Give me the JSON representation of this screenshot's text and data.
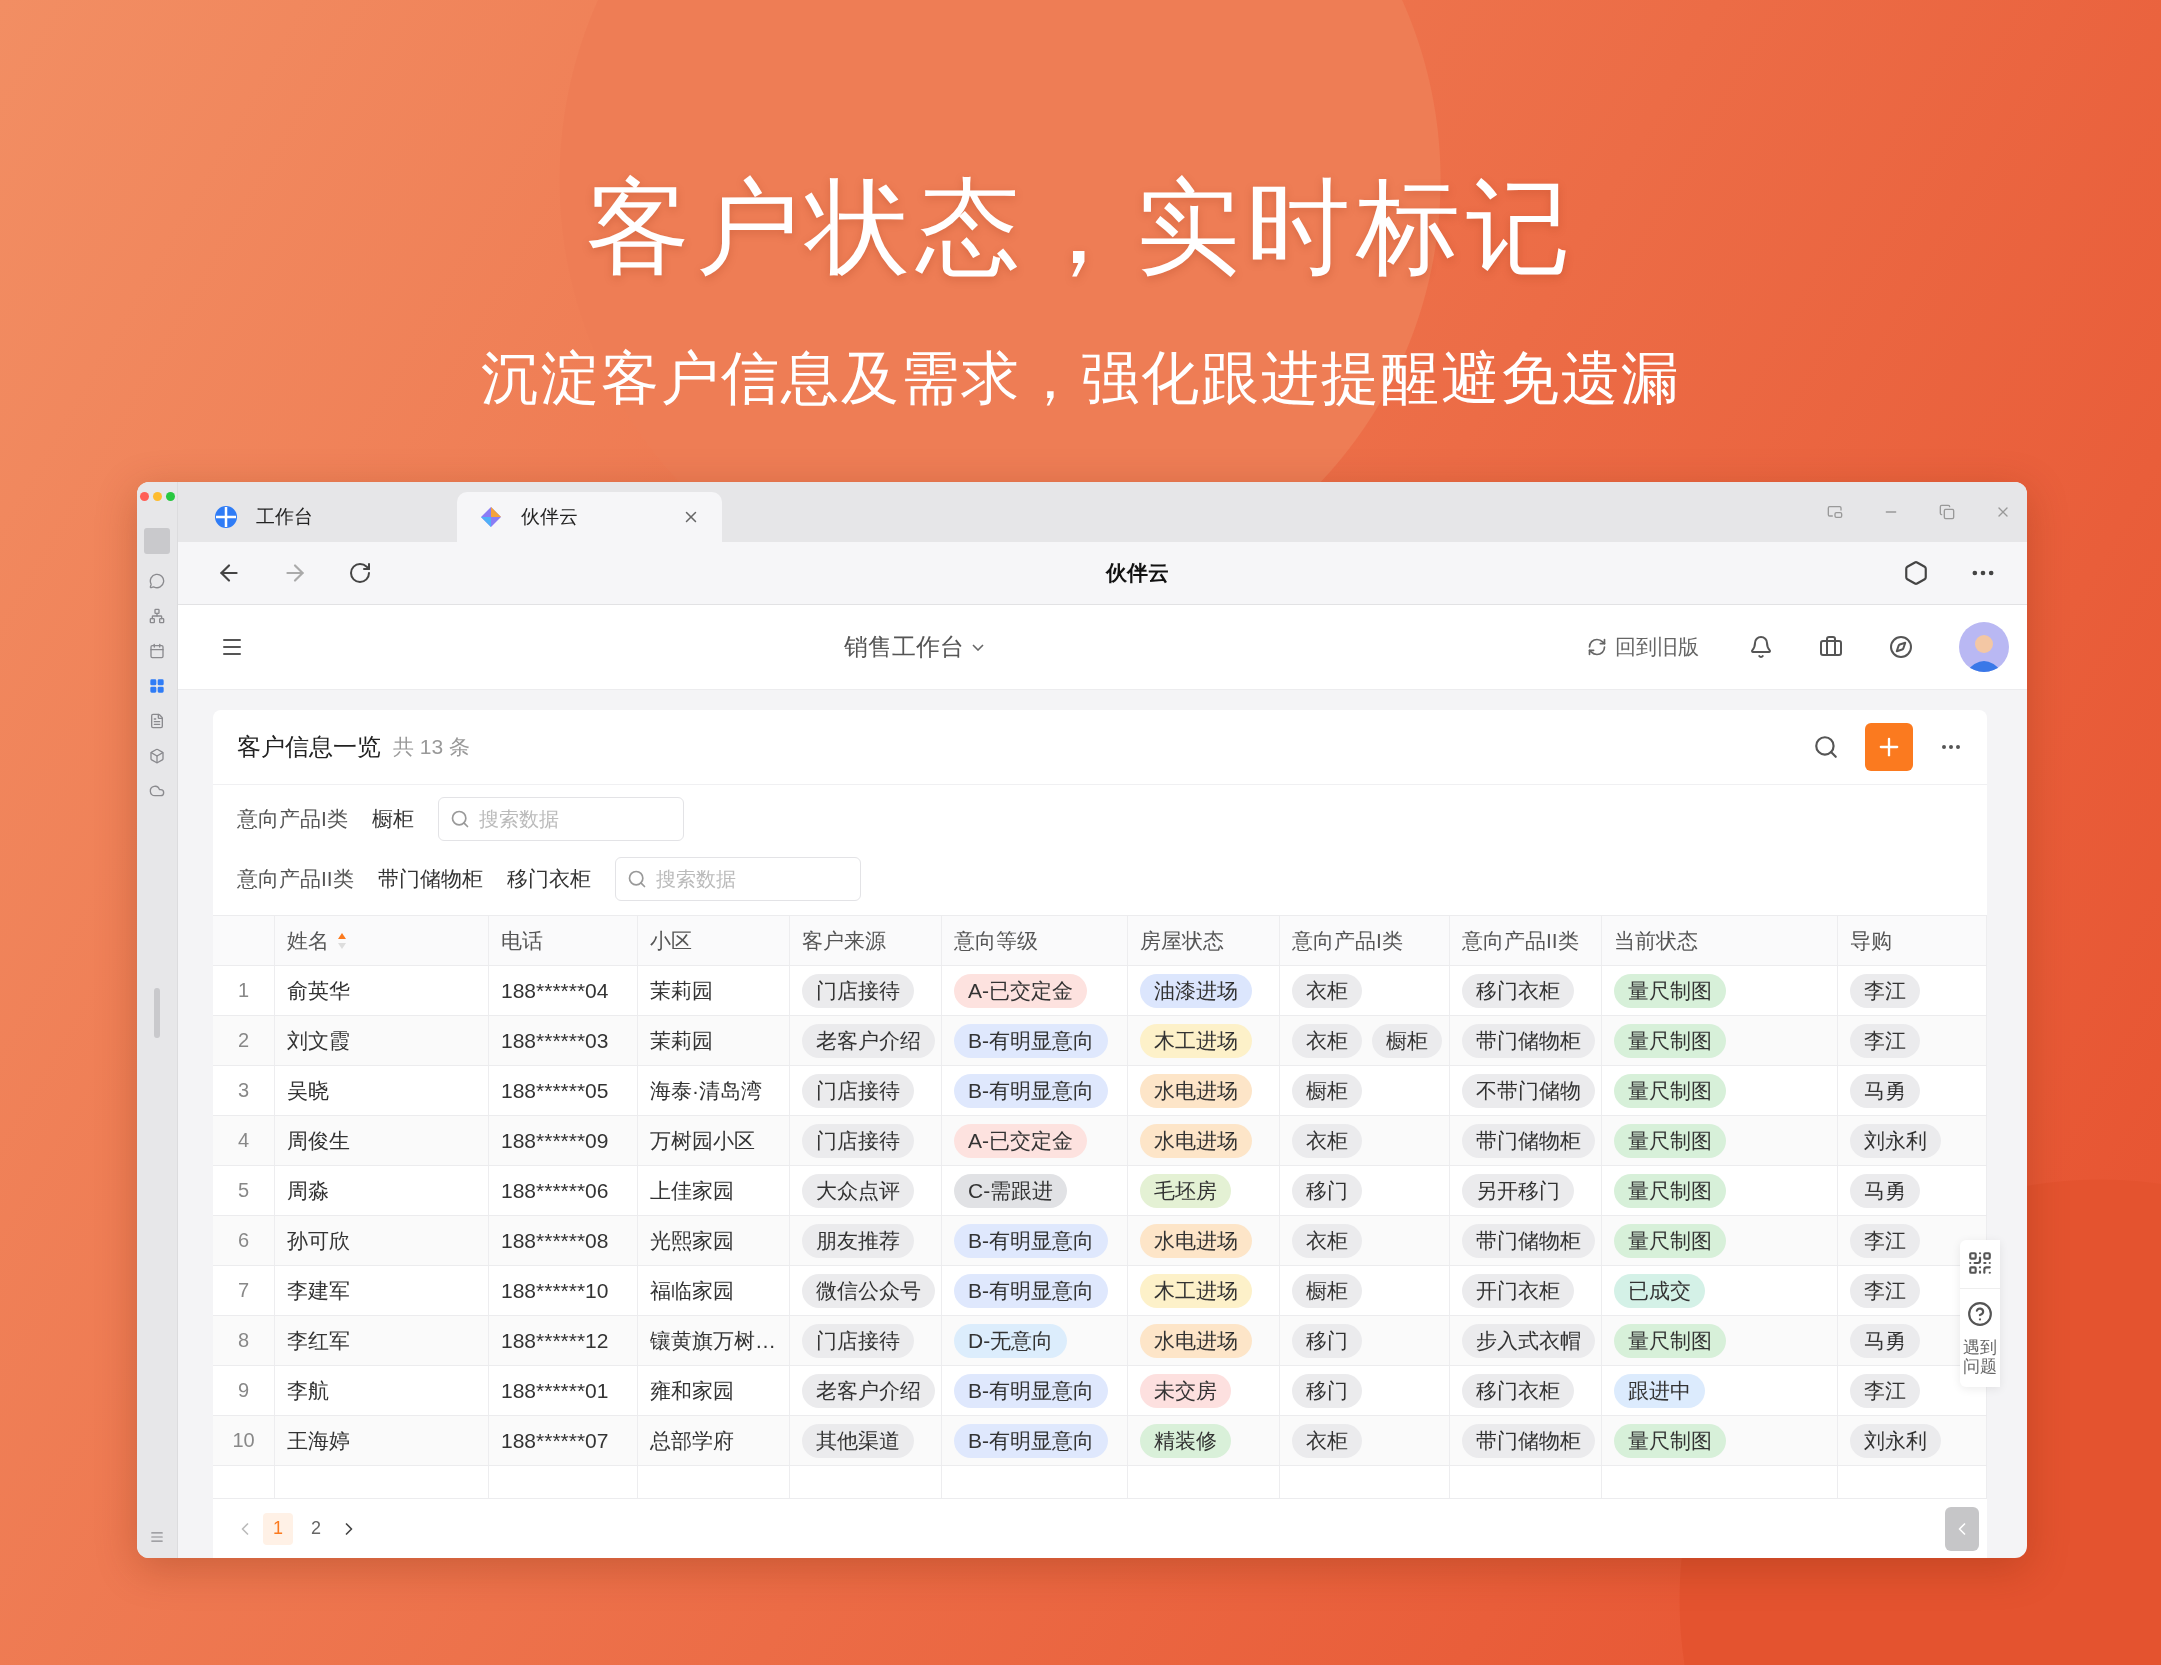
{
  "hero": {
    "title": "客户状态，实时标记",
    "subtitle": "沉淀客户信息及需求，强化跟进提醒避免遗漏"
  },
  "browser": {
    "tabs": [
      {
        "label": "工作台",
        "selected": false
      },
      {
        "label": "伙伴云",
        "selected": true
      }
    ],
    "page_title": "伙伴云"
  },
  "app_header": {
    "workspace": "销售工作台",
    "old_version": "回到旧版"
  },
  "card": {
    "title": "客户信息一览",
    "count": "共 13 条"
  },
  "filters": [
    {
      "label": "意向产品I类",
      "values": [
        "橱柜"
      ],
      "placeholder": "搜索数据"
    },
    {
      "label": "意向产品II类",
      "values": [
        "带门储物柜",
        "移门衣柜"
      ],
      "placeholder": "搜索数据"
    }
  ],
  "table": {
    "columns": [
      {
        "label": "姓名",
        "sorted": true
      },
      {
        "label": "电话",
        "sorted": false
      },
      {
        "label": "小区",
        "sorted": false
      },
      {
        "label": "客户来源",
        "sorted": false
      },
      {
        "label": "意向等级",
        "sorted": false
      },
      {
        "label": "房屋状态",
        "sorted": false
      },
      {
        "label": "意向产品I类",
        "sorted": false
      },
      {
        "label": "意向产品II类",
        "sorted": false
      },
      {
        "label": "当前状态",
        "sorted": false
      },
      {
        "label": "导购",
        "sorted": false
      }
    ],
    "rows": [
      {
        "index": "1",
        "cells": [
          {
            "kind": "text",
            "text": "俞英华"
          },
          {
            "kind": "text",
            "text": "188******04"
          },
          {
            "kind": "text",
            "text": "茉莉园"
          },
          {
            "kind": "tags",
            "tags": [
              {
                "text": "门店接待",
                "color": "#ebebed"
              }
            ]
          },
          {
            "kind": "tags",
            "tags": [
              {
                "text": "A-已交定金",
                "color": "#fde2df"
              }
            ]
          },
          {
            "kind": "tags",
            "tags": [
              {
                "text": "油漆进场",
                "color": "#dce6fd"
              }
            ]
          },
          {
            "kind": "tags",
            "tags": [
              {
                "text": "衣柜",
                "color": "#ebebed"
              }
            ]
          },
          {
            "kind": "tags",
            "tags": [
              {
                "text": "移门衣柜",
                "color": "#ebebed"
              }
            ]
          },
          {
            "kind": "tags",
            "tags": [
              {
                "text": "量尺制图",
                "color": "#d7f0d9"
              }
            ]
          },
          {
            "kind": "tags",
            "tags": [
              {
                "text": "李江",
                "color": "#ebebed"
              }
            ]
          }
        ]
      },
      {
        "index": "2",
        "cells": [
          {
            "kind": "text",
            "text": "刘文霞"
          },
          {
            "kind": "text",
            "text": "188******03"
          },
          {
            "kind": "text",
            "text": "茉莉园"
          },
          {
            "kind": "tags",
            "tags": [
              {
                "text": "老客户介绍",
                "color": "#ebebed"
              }
            ]
          },
          {
            "kind": "tags",
            "tags": [
              {
                "text": "B-有明显意向",
                "color": "#dfe8fd"
              }
            ]
          },
          {
            "kind": "tags",
            "tags": [
              {
                "text": "木工进场",
                "color": "#fdf1c9"
              }
            ]
          },
          {
            "kind": "tags",
            "tags": [
              {
                "text": "衣柜",
                "color": "#ebebed"
              },
              {
                "text": "橱柜",
                "color": "#ebebed"
              }
            ]
          },
          {
            "kind": "tags",
            "tags": [
              {
                "text": "带门储物柜",
                "color": "#ebebed"
              }
            ]
          },
          {
            "kind": "tags",
            "tags": [
              {
                "text": "量尺制图",
                "color": "#d7f0d9"
              }
            ]
          },
          {
            "kind": "tags",
            "tags": [
              {
                "text": "李江",
                "color": "#ebebed"
              }
            ]
          }
        ]
      },
      {
        "index": "3",
        "cells": [
          {
            "kind": "text",
            "text": "吴晓"
          },
          {
            "kind": "text",
            "text": "188******05"
          },
          {
            "kind": "text",
            "text": "海泰·清岛湾"
          },
          {
            "kind": "tags",
            "tags": [
              {
                "text": "门店接待",
                "color": "#ebebed"
              }
            ]
          },
          {
            "kind": "tags",
            "tags": [
              {
                "text": "B-有明显意向",
                "color": "#dfe8fd"
              }
            ]
          },
          {
            "kind": "tags",
            "tags": [
              {
                "text": "水电进场",
                "color": "#fde5c8"
              }
            ]
          },
          {
            "kind": "tags",
            "tags": [
              {
                "text": "橱柜",
                "color": "#ebebed"
              }
            ]
          },
          {
            "kind": "tags",
            "tags": [
              {
                "text": "不带门储物",
                "color": "#ebebed"
              }
            ]
          },
          {
            "kind": "tags",
            "tags": [
              {
                "text": "量尺制图",
                "color": "#d7f0d9"
              }
            ]
          },
          {
            "kind": "tags",
            "tags": [
              {
                "text": "马勇",
                "color": "#ebebed"
              }
            ]
          }
        ]
      },
      {
        "index": "4",
        "cells": [
          {
            "kind": "text",
            "text": "周俊生"
          },
          {
            "kind": "text",
            "text": "188******09"
          },
          {
            "kind": "text",
            "text": "万树园小区"
          },
          {
            "kind": "tags",
            "tags": [
              {
                "text": "门店接待",
                "color": "#ebebed"
              }
            ]
          },
          {
            "kind": "tags",
            "tags": [
              {
                "text": "A-已交定金",
                "color": "#fde2df"
              }
            ]
          },
          {
            "kind": "tags",
            "tags": [
              {
                "text": "水电进场",
                "color": "#fde5c8"
              }
            ]
          },
          {
            "kind": "tags",
            "tags": [
              {
                "text": "衣柜",
                "color": "#ebebed"
              }
            ]
          },
          {
            "kind": "tags",
            "tags": [
              {
                "text": "带门储物柜",
                "color": "#ebebed"
              }
            ]
          },
          {
            "kind": "tags",
            "tags": [
              {
                "text": "量尺制图",
                "color": "#d7f0d9"
              }
            ]
          },
          {
            "kind": "tags",
            "tags": [
              {
                "text": "刘永利",
                "color": "#ebebed"
              }
            ]
          }
        ]
      },
      {
        "index": "5",
        "cells": [
          {
            "kind": "text",
            "text": "周淼"
          },
          {
            "kind": "text",
            "text": "188******06"
          },
          {
            "kind": "text",
            "text": "上佳家园"
          },
          {
            "kind": "tags",
            "tags": [
              {
                "text": "大众点评",
                "color": "#ebebed"
              }
            ]
          },
          {
            "kind": "tags",
            "tags": [
              {
                "text": "C-需跟进",
                "color": "#e1e2e5"
              }
            ]
          },
          {
            "kind": "tags",
            "tags": [
              {
                "text": "毛坯房",
                "color": "#e4f1d4"
              }
            ]
          },
          {
            "kind": "tags",
            "tags": [
              {
                "text": "移门",
                "color": "#ebebed"
              }
            ]
          },
          {
            "kind": "tags",
            "tags": [
              {
                "text": "另开移门",
                "color": "#ebebed"
              }
            ]
          },
          {
            "kind": "tags",
            "tags": [
              {
                "text": "量尺制图",
                "color": "#d7f0d9"
              }
            ]
          },
          {
            "kind": "tags",
            "tags": [
              {
                "text": "马勇",
                "color": "#ebebed"
              }
            ]
          }
        ]
      },
      {
        "index": "6",
        "cells": [
          {
            "kind": "text",
            "text": "孙可欣"
          },
          {
            "kind": "text",
            "text": "188******08"
          },
          {
            "kind": "text",
            "text": "光熙家园"
          },
          {
            "kind": "tags",
            "tags": [
              {
                "text": "朋友推荐",
                "color": "#ebebed"
              }
            ]
          },
          {
            "kind": "tags",
            "tags": [
              {
                "text": "B-有明显意向",
                "color": "#dfe8fd"
              }
            ]
          },
          {
            "kind": "tags",
            "tags": [
              {
                "text": "水电进场",
                "color": "#fde5c8"
              }
            ]
          },
          {
            "kind": "tags",
            "tags": [
              {
                "text": "衣柜",
                "color": "#ebebed"
              }
            ]
          },
          {
            "kind": "tags",
            "tags": [
              {
                "text": "带门储物柜",
                "color": "#ebebed"
              }
            ]
          },
          {
            "kind": "tags",
            "tags": [
              {
                "text": "量尺制图",
                "color": "#d7f0d9"
              }
            ]
          },
          {
            "kind": "tags",
            "tags": [
              {
                "text": "李江",
                "color": "#ebebed"
              }
            ]
          }
        ]
      },
      {
        "index": "7",
        "cells": [
          {
            "kind": "text",
            "text": "李建军"
          },
          {
            "kind": "text",
            "text": "188******10"
          },
          {
            "kind": "text",
            "text": "福临家园"
          },
          {
            "kind": "tags",
            "tags": [
              {
                "text": "微信公众号",
                "color": "#ebebed"
              }
            ]
          },
          {
            "kind": "tags",
            "tags": [
              {
                "text": "B-有明显意向",
                "color": "#dfe8fd"
              }
            ]
          },
          {
            "kind": "tags",
            "tags": [
              {
                "text": "木工进场",
                "color": "#fdf1c9"
              }
            ]
          },
          {
            "kind": "tags",
            "tags": [
              {
                "text": "橱柜",
                "color": "#ebebed"
              }
            ]
          },
          {
            "kind": "tags",
            "tags": [
              {
                "text": "开门衣柜",
                "color": "#ebebed"
              }
            ]
          },
          {
            "kind": "tags",
            "tags": [
              {
                "text": "已成交",
                "color": "#d4f1e7"
              }
            ]
          },
          {
            "kind": "tags",
            "tags": [
              {
                "text": "李江",
                "color": "#ebebed"
              }
            ]
          }
        ]
      },
      {
        "index": "8",
        "cells": [
          {
            "kind": "text",
            "text": "李红军"
          },
          {
            "kind": "text",
            "text": "188******12"
          },
          {
            "kind": "text",
            "text": "镶黄旗万树…"
          },
          {
            "kind": "tags",
            "tags": [
              {
                "text": "门店接待",
                "color": "#ebebed"
              }
            ]
          },
          {
            "kind": "tags",
            "tags": [
              {
                "text": "D-无意向",
                "color": "#dcedfc"
              }
            ]
          },
          {
            "kind": "tags",
            "tags": [
              {
                "text": "水电进场",
                "color": "#fde5c8"
              }
            ]
          },
          {
            "kind": "tags",
            "tags": [
              {
                "text": "移门",
                "color": "#ebebed"
              }
            ]
          },
          {
            "kind": "tags",
            "tags": [
              {
                "text": "步入式衣帽",
                "color": "#ebebed"
              }
            ]
          },
          {
            "kind": "tags",
            "tags": [
              {
                "text": "量尺制图",
                "color": "#d7f0d9"
              }
            ]
          },
          {
            "kind": "tags",
            "tags": [
              {
                "text": "马勇",
                "color": "#ebebed"
              }
            ]
          }
        ]
      },
      {
        "index": "9",
        "cells": [
          {
            "kind": "text",
            "text": "李航"
          },
          {
            "kind": "text",
            "text": "188******01"
          },
          {
            "kind": "text",
            "text": "雍和家园"
          },
          {
            "kind": "tags",
            "tags": [
              {
                "text": "老客户介绍",
                "color": "#ebebed"
              }
            ]
          },
          {
            "kind": "tags",
            "tags": [
              {
                "text": "B-有明显意向",
                "color": "#dfe8fd"
              }
            ]
          },
          {
            "kind": "tags",
            "tags": [
              {
                "text": "未交房",
                "color": "#fde0df"
              }
            ]
          },
          {
            "kind": "tags",
            "tags": [
              {
                "text": "移门",
                "color": "#ebebed"
              }
            ]
          },
          {
            "kind": "tags",
            "tags": [
              {
                "text": "移门衣柜",
                "color": "#ebebed"
              }
            ]
          },
          {
            "kind": "tags",
            "tags": [
              {
                "text": "跟进中",
                "color": "#dcebfd"
              }
            ]
          },
          {
            "kind": "tags",
            "tags": [
              {
                "text": "李江",
                "color": "#ebebed"
              }
            ]
          }
        ]
      },
      {
        "index": "10",
        "cells": [
          {
            "kind": "text",
            "text": "王海婷"
          },
          {
            "kind": "text",
            "text": "188******07"
          },
          {
            "kind": "text",
            "text": "总部学府"
          },
          {
            "kind": "tags",
            "tags": [
              {
                "text": "其他渠道",
                "color": "#ebebed"
              }
            ]
          },
          {
            "kind": "tags",
            "tags": [
              {
                "text": "B-有明显意向",
                "color": "#dfe8fd"
              }
            ]
          },
          {
            "kind": "tags",
            "tags": [
              {
                "text": "精装修",
                "color": "#d9f0d9"
              }
            ]
          },
          {
            "kind": "tags",
            "tags": [
              {
                "text": "衣柜",
                "color": "#ebebed"
              }
            ]
          },
          {
            "kind": "tags",
            "tags": [
              {
                "text": "带门储物柜",
                "color": "#ebebed"
              }
            ]
          },
          {
            "kind": "tags",
            "tags": [
              {
                "text": "量尺制图",
                "color": "#d7f0d9"
              }
            ]
          },
          {
            "kind": "tags",
            "tags": [
              {
                "text": "刘永利",
                "color": "#ebebed"
              }
            ]
          }
        ]
      }
    ]
  },
  "pagination": {
    "pages": [
      {
        "label": "1",
        "selected": true
      },
      {
        "label": "2",
        "selected": false
      }
    ]
  },
  "help": {
    "label": "遇到问题"
  }
}
